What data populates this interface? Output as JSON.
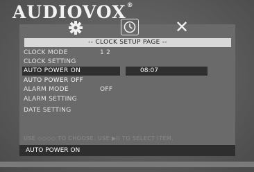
{
  "brand": {
    "name": "AUDIOVOX",
    "mark": "®"
  },
  "top_icons": {
    "setup": "gear-icon",
    "clock": "clock-icon",
    "exit": "close-icon"
  },
  "page_title": "-- CLOCK SETUP PAGE --",
  "menu": {
    "items": [
      {
        "label": "CLOCK MODE",
        "value": "1 2"
      },
      {
        "label": "CLOCK SETTING",
        "value": ""
      },
      {
        "label": "AUTO POWER ON",
        "value": "08:07"
      },
      {
        "label": "AUTO POWER OFF",
        "value": ""
      },
      {
        "label": "ALARM MODE",
        "value": "OFF"
      },
      {
        "label": "ALARM SETTING",
        "value": ""
      },
      {
        "label": "DATE SETTING",
        "value": ""
      }
    ],
    "selected_index": 2
  },
  "hint": {
    "before": "USE",
    "arrows": "◇◇◇◇",
    "middle": "TO CHOOSE. USE",
    "play_pause": "▶II",
    "after": "TO SELECT ITEM."
  },
  "status": "AUTO POWER ON",
  "colors": {
    "highlight": "#2f2f2f",
    "title_bar": "#d9d9d9",
    "panel": "#6a6a6a"
  }
}
